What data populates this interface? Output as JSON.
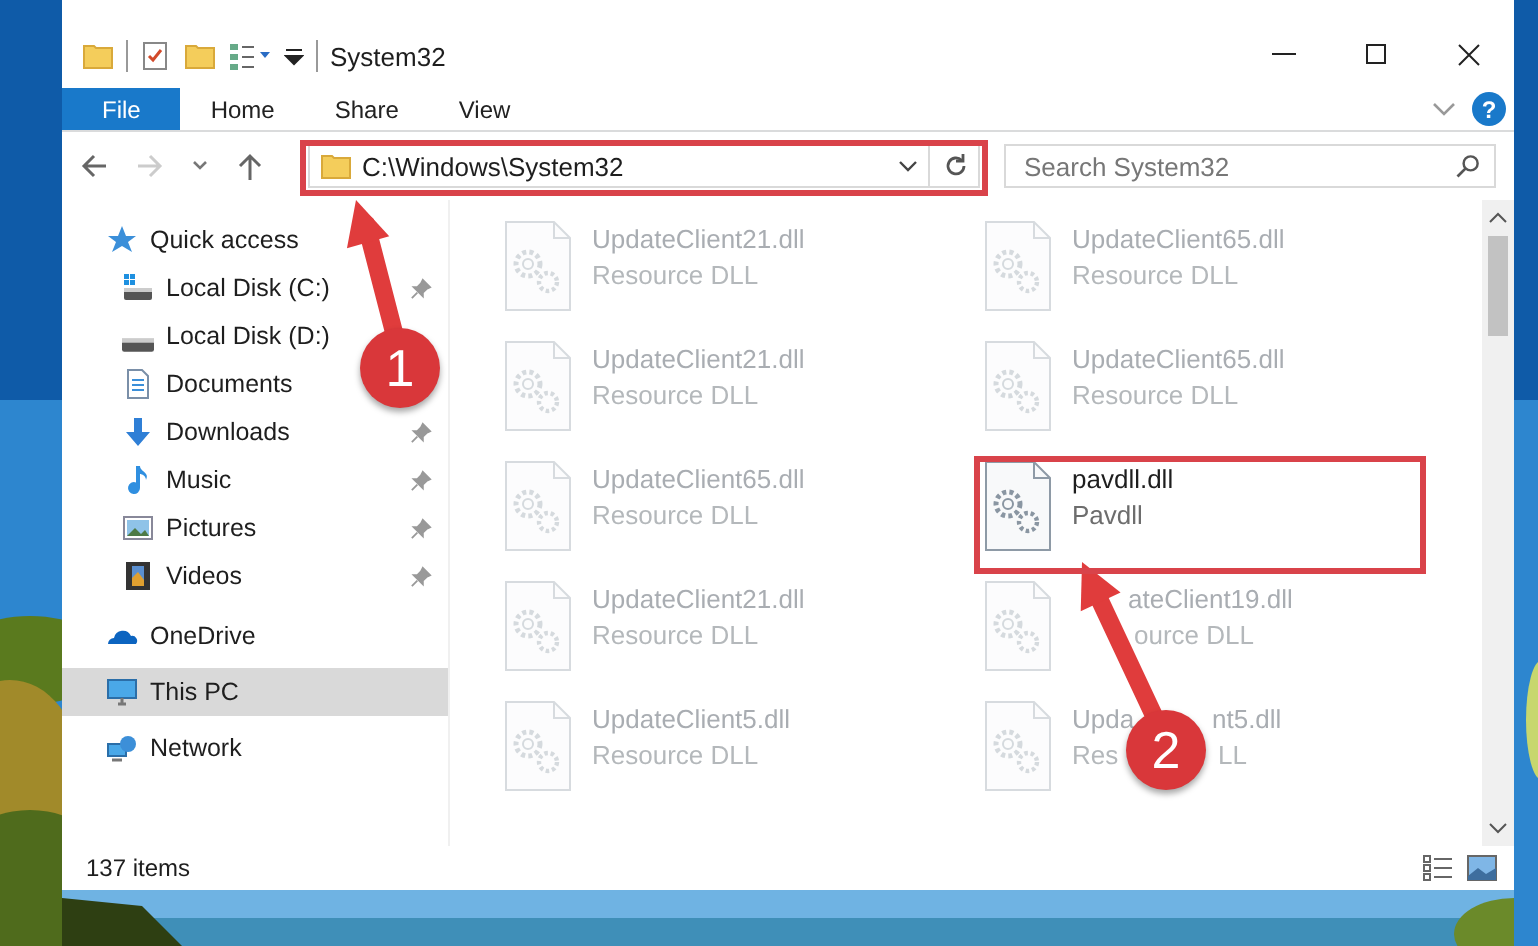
{
  "window": {
    "title": "System32"
  },
  "ribbon": {
    "tabs": [
      {
        "label": "File",
        "kind": "file"
      },
      {
        "label": "Home",
        "kind": "tab"
      },
      {
        "label": "Share",
        "kind": "tab"
      },
      {
        "label": "View",
        "kind": "tab"
      }
    ],
    "help": "?"
  },
  "address_bar": {
    "path": "C:\\Windows\\System32"
  },
  "search": {
    "placeholder": "Search System32"
  },
  "navigation": [
    {
      "label": "Quick access",
      "selected": false,
      "children": [
        {
          "label": "Local Disk (C:)",
          "pinned": true,
          "selected": false
        },
        {
          "label": "Local Disk (D:)",
          "selected": false
        },
        {
          "label": "Documents",
          "selected": false
        },
        {
          "label": "Downloads",
          "pinned": true,
          "selected": false
        },
        {
          "label": "Music",
          "pinned": true,
          "selected": false
        },
        {
          "label": "Pictures",
          "pinned": true,
          "selected": false
        },
        {
          "label": "Videos",
          "pinned": true,
          "selected": false
        }
      ]
    },
    {
      "label": "OneDrive",
      "selected": false
    },
    {
      "label": "This PC",
      "selected": true
    },
    {
      "label": "Network",
      "selected": false
    }
  ],
  "files": [
    {
      "name_parts": [
        "UpdateClient21.dll"
      ],
      "type_parts": [
        "Resource DLL"
      ],
      "dimmed": true
    },
    {
      "name_parts": [
        "UpdateClient65.dll"
      ],
      "type_parts": [
        "Resource DLL"
      ],
      "dimmed": true
    },
    {
      "name_parts": [
        "UpdateClient21.dll"
      ],
      "type_parts": [
        "Resource DLL"
      ],
      "dimmed": true
    },
    {
      "name_parts": [
        "UpdateClient65.dll"
      ],
      "type_parts": [
        "Resource DLL"
      ],
      "dimmed": true
    },
    {
      "name_parts": [
        "UpdateClient65.dll"
      ],
      "type_parts": [
        "Resource DLL"
      ],
      "dimmed": true
    },
    {
      "name_parts": [
        "pavdll.dll"
      ],
      "type_parts": [
        "Pavdll"
      ],
      "dimmed": false
    },
    {
      "name_parts": [
        "UpdateClient21.dll"
      ],
      "type_parts": [
        "Resource DLL"
      ],
      "dimmed": true
    },
    {
      "name_parts": [
        "ateClient19.dll"
      ],
      "type_parts": [
        "ource DLL"
      ],
      "dimmed": true
    },
    {
      "name_parts": [
        "UpdateClient5.dll"
      ],
      "type_parts": [
        "Resource DLL"
      ],
      "dimmed": true
    },
    {
      "name_parts": [
        "Upda",
        "nt5.dll"
      ],
      "type_parts": [
        "Res",
        "LL"
      ],
      "dimmed": true
    }
  ],
  "status_bar": {
    "item_count": "137 items"
  },
  "annotations": [
    {
      "number": "1"
    },
    {
      "number": "2"
    }
  ]
}
